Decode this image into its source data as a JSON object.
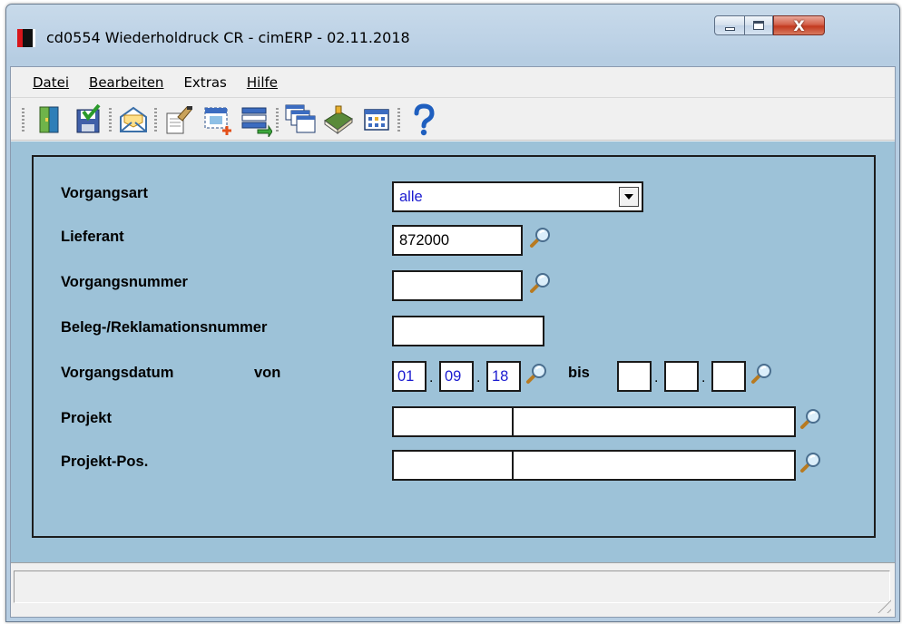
{
  "window": {
    "title": "cd0554 Wiederholdruck CR - cimERP - 02.11.2018",
    "close_label": "X"
  },
  "menu": {
    "items": [
      {
        "label": "Datei",
        "underline": "D"
      },
      {
        "label": "Bearbeiten",
        "underline": "B"
      },
      {
        "label": "Extras",
        "underline": "x"
      },
      {
        "label": "Hilfe",
        "underline": "H"
      }
    ]
  },
  "toolbar": {
    "buttons": [
      {
        "icon": "exit-door-icon"
      },
      {
        "icon": "save-check-icon"
      },
      {
        "icon": "envelope-icon"
      },
      {
        "icon": "edit-document-icon"
      },
      {
        "icon": "new-window-icon"
      },
      {
        "icon": "list-transfer-icon"
      },
      {
        "icon": "windows-cascade-icon"
      },
      {
        "icon": "book-icon"
      },
      {
        "icon": "calendar-grid-icon"
      },
      {
        "icon": "help-question-icon"
      }
    ]
  },
  "form": {
    "vorgangsart": {
      "label": "Vorgangsart",
      "value": "alle"
    },
    "lieferant": {
      "label": "Lieferant",
      "value": "872000"
    },
    "vorgangsnummer": {
      "label": "Vorgangsnummer",
      "value": ""
    },
    "belegnummer": {
      "label": "Beleg-/Reklamationsnummer",
      "value": ""
    },
    "vorgangsdatum": {
      "label": "Vorgangsdatum",
      "von_label": "von",
      "bis_label": "bis",
      "from": {
        "day": "01",
        "month": "09",
        "year": "18"
      },
      "to": {
        "day": "",
        "month": "",
        "year": ""
      },
      "separator": "."
    },
    "projekt": {
      "label": "Projekt",
      "code": "",
      "name": ""
    },
    "projekt_pos": {
      "label": "Projekt-Pos.",
      "code": "",
      "name": ""
    }
  },
  "statusbar": {
    "text": ""
  },
  "colors": {
    "form_background": "#9dc2d8",
    "field_value_blue": "#1b1bd0",
    "close_button_red": "#c3391f"
  }
}
